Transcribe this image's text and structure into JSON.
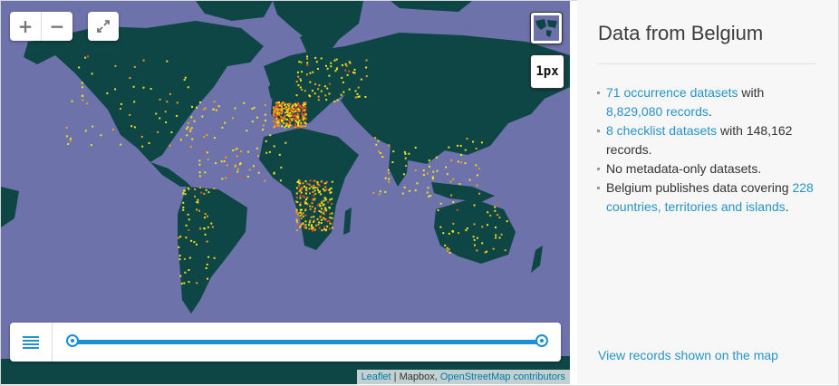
{
  "map": {
    "controls": {
      "zoom_in": "+",
      "zoom_out": "−",
      "fullscreen_icon": "expand-arrows-icon",
      "pixel_size": "1px"
    },
    "colors": {
      "ocean": "#6e72aa",
      "land": "#0e4545",
      "occurrence_low": "#f4e41a",
      "occurrence_mid": "#f0a21a",
      "occurrence_high": "#e8522a",
      "slider": "#1a8fd8"
    },
    "timeline": {
      "menu_icon": "list-menu-icon",
      "start_position": 0,
      "end_position": 1
    },
    "attribution": {
      "leaflet": "Leaflet",
      "separator": " | Mapbox, ",
      "osm": "OpenStreetMap contributors"
    }
  },
  "panel": {
    "title": "Data from Belgium",
    "items": [
      {
        "link": "71 occurrence datasets",
        "text": " with ",
        "link2": "8,829,080 records",
        "tail": "."
      },
      {
        "link": "8 checklist datasets",
        "text": " with 148,162 records."
      },
      {
        "text": "No metadata-only datasets."
      },
      {
        "text": "Belgium publishes data covering ",
        "link": "228 countries, territories and islands",
        "tail": "."
      }
    ],
    "view_link": "View records shown on the map"
  }
}
